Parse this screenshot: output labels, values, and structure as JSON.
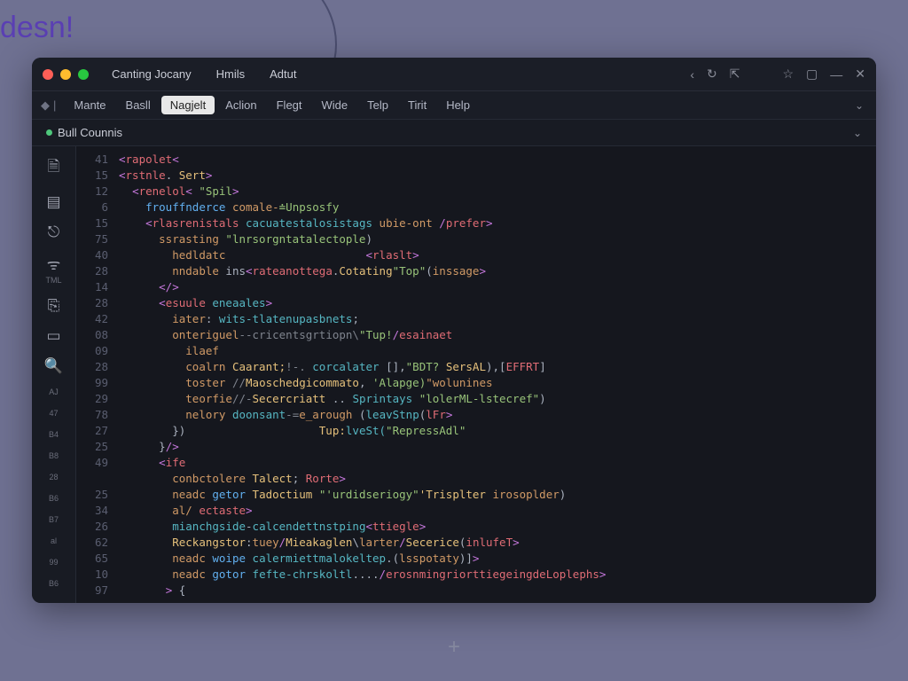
{
  "background": {
    "partial_word": "desn!"
  },
  "titlebar": {
    "tabs": [
      "Canting Jocany",
      "Hmils",
      "Adtut"
    ],
    "nav": {
      "back": "‹",
      "reload": "↻",
      "forward": "⇱",
      "star": "☆",
      "panel": "▢",
      "minimize": "—",
      "close": "✕"
    }
  },
  "menubar": {
    "pre_icon": "◆",
    "pre_sep": "|",
    "items": [
      "Mante",
      "Basll",
      "Nagjelt",
      "Aclion",
      "Flegt",
      "Wide",
      "Telp",
      "Tirit",
      "Help"
    ],
    "active_index": 2,
    "end": "⌄"
  },
  "tabbar": {
    "file_name": "Bull Counnis",
    "end": "⌄"
  },
  "activity": [
    {
      "icon": "🗎",
      "label": ""
    },
    {
      "icon": "▤",
      "label": ""
    },
    {
      "icon": "⎋",
      "label": ""
    },
    {
      "icon": "ᯤ",
      "label": "TML"
    },
    {
      "icon": "⎘",
      "label": ""
    },
    {
      "icon": "▭",
      "label": ""
    },
    {
      "icon": "🔍",
      "label": ""
    },
    {
      "icon": "",
      "label": "AJ"
    },
    {
      "icon": "",
      "label": "47"
    },
    {
      "icon": "",
      "label": "B4"
    },
    {
      "icon": "",
      "label": "B8"
    },
    {
      "icon": "",
      "label": "28"
    },
    {
      "icon": "",
      "label": "B6"
    },
    {
      "icon": "",
      "label": "B7"
    },
    {
      "icon": "",
      "label": "al"
    },
    {
      "icon": "",
      "label": "99"
    },
    {
      "icon": "",
      "label": "B6"
    }
  ],
  "gutter": [
    "41",
    "15",
    "12",
    "6",
    "15",
    "75",
    "40",
    "28",
    "14",
    "28",
    "42",
    "08",
    "09",
    "28",
    "99",
    "29",
    "78",
    "27",
    "25",
    "49",
    "",
    "25",
    "34",
    "26",
    "62",
    "65",
    "10",
    "97"
  ],
  "code_lines": [
    [
      {
        "c": "p",
        "t": "<"
      },
      {
        "c": "t",
        "t": "rapolet"
      },
      {
        "c": "p",
        "t": "<"
      }
    ],
    [
      {
        "c": "p",
        "t": "<"
      },
      {
        "c": "t",
        "t": "rstnle"
      },
      {
        "c": "w",
        "t": ". "
      },
      {
        "c": "y",
        "t": "Sert"
      },
      {
        "c": "p",
        "t": ">"
      }
    ],
    [
      {
        "c": "w",
        "t": "  "
      },
      {
        "c": "p",
        "t": "<"
      },
      {
        "c": "t",
        "t": "renelol"
      },
      {
        "c": "p",
        "t": "< "
      },
      {
        "c": "s",
        "t": "\"Spil"
      },
      {
        "c": "p",
        "t": ">"
      }
    ],
    [
      {
        "c": "w",
        "t": "    "
      },
      {
        "c": "k",
        "t": "frouffnderce"
      },
      {
        "c": "w",
        "t": " "
      },
      {
        "c": "a",
        "t": "comale-"
      },
      {
        "c": "s",
        "t": "≐Unpsosfy"
      }
    ],
    [
      {
        "c": "w",
        "t": "    "
      },
      {
        "c": "p",
        "t": "<"
      },
      {
        "c": "t",
        "t": "rlasrenistals"
      },
      {
        "c": "w",
        "t": " "
      },
      {
        "c": "g",
        "t": "cacuatestalosistags"
      },
      {
        "c": "w",
        "t": " "
      },
      {
        "c": "a",
        "t": "ubie-ont"
      },
      {
        "c": "w",
        "t": " "
      },
      {
        "c": "p",
        "t": "/"
      },
      {
        "c": "t",
        "t": "prefer"
      },
      {
        "c": "p",
        "t": ">"
      }
    ],
    [
      {
        "c": "w",
        "t": "      "
      },
      {
        "c": "a",
        "t": "ssrasting"
      },
      {
        "c": "w",
        "t": " "
      },
      {
        "c": "s",
        "t": "\"lnrsorgntatalectople"
      },
      {
        "c": "w",
        "t": ")"
      }
    ],
    [
      {
        "c": "w",
        "t": "        "
      },
      {
        "c": "a",
        "t": "hedldatc"
      },
      {
        "c": "w",
        "t": "                     "
      },
      {
        "c": "p",
        "t": "<"
      },
      {
        "c": "t",
        "t": "rlaslt"
      },
      {
        "c": "p",
        "t": ">"
      }
    ],
    [
      {
        "c": "w",
        "t": "        "
      },
      {
        "c": "a",
        "t": "nndable"
      },
      {
        "c": "w",
        "t": " ins"
      },
      {
        "c": "p",
        "t": "<"
      },
      {
        "c": "t",
        "t": "rateanottega"
      },
      {
        "c": "w",
        "t": "."
      },
      {
        "c": "y",
        "t": "Cotating"
      },
      {
        "c": "s",
        "t": "\"Top\""
      },
      {
        "c": "w",
        "t": "("
      },
      {
        "c": "a",
        "t": "inssage"
      },
      {
        "c": "p",
        "t": ">"
      }
    ],
    [
      {
        "c": "w",
        "t": "      "
      },
      {
        "c": "p",
        "t": "</"
      },
      {
        "c": "p",
        "t": ">"
      }
    ],
    [
      {
        "c": "w",
        "t": "      "
      },
      {
        "c": "p",
        "t": "<"
      },
      {
        "c": "t",
        "t": "esuule"
      },
      {
        "c": "w",
        "t": " "
      },
      {
        "c": "g",
        "t": "eneaales"
      },
      {
        "c": "p",
        "t": ">"
      }
    ],
    [
      {
        "c": "w",
        "t": "        "
      },
      {
        "c": "a",
        "t": "iater"
      },
      {
        "c": "w",
        "t": ": "
      },
      {
        "c": "g",
        "t": "wits-tlatenupasbnets"
      },
      {
        "c": "w",
        "t": ";"
      }
    ],
    [
      {
        "c": "w",
        "t": "        "
      },
      {
        "c": "a",
        "t": "onteriguel"
      },
      {
        "c": "c",
        "t": "--cricentsgrtiopn\\"
      },
      {
        "c": "s",
        "t": "\"Tup!"
      },
      {
        "c": "p",
        "t": "/"
      },
      {
        "c": "t",
        "t": "esainaet"
      }
    ],
    [
      {
        "c": "w",
        "t": "          "
      },
      {
        "c": "a",
        "t": "ilaef"
      }
    ],
    [
      {
        "c": "w",
        "t": "          "
      },
      {
        "c": "a",
        "t": "coalrn"
      },
      {
        "c": "w",
        "t": " "
      },
      {
        "c": "y",
        "t": "Caarant;"
      },
      {
        "c": "c",
        "t": "!-. "
      },
      {
        "c": "g",
        "t": "corcalater"
      },
      {
        "c": "w",
        "t": " [],"
      },
      {
        "c": "s",
        "t": "\"BDT?"
      },
      {
        "c": "w",
        "t": " "
      },
      {
        "c": "y",
        "t": "SersAL"
      },
      {
        "c": "w",
        "t": "),["
      },
      {
        "c": "t",
        "t": "EFFRT"
      },
      {
        "c": "w",
        "t": "]"
      }
    ],
    [
      {
        "c": "w",
        "t": "          "
      },
      {
        "c": "a",
        "t": "toster"
      },
      {
        "c": "w",
        "t": " "
      },
      {
        "c": "c",
        "t": "//"
      },
      {
        "c": "y",
        "t": "Maoschedgicommato"
      },
      {
        "c": "w",
        "t": ", "
      },
      {
        "c": "s",
        "t": "'Alapge)"
      },
      {
        "c": "a",
        "t": "\"wolunines"
      }
    ],
    [
      {
        "c": "w",
        "t": "          "
      },
      {
        "c": "a",
        "t": "teorfie"
      },
      {
        "c": "c",
        "t": "//-"
      },
      {
        "c": "y",
        "t": "Secercriatt"
      },
      {
        "c": "w",
        "t": " .. "
      },
      {
        "c": "g",
        "t": "Sprintays"
      },
      {
        "c": "w",
        "t": " "
      },
      {
        "c": "s",
        "t": "\"lolerML-lstecref\""
      },
      {
        "c": "w",
        "t": ")"
      }
    ],
    [
      {
        "c": "w",
        "t": "          "
      },
      {
        "c": "a",
        "t": "nelory"
      },
      {
        "c": "w",
        "t": " "
      },
      {
        "c": "g",
        "t": "doonsant"
      },
      {
        "c": "c",
        "t": "-="
      },
      {
        "c": "a",
        "t": "e_arough"
      },
      {
        "c": "w",
        "t": " ("
      },
      {
        "c": "g",
        "t": "leavStnp"
      },
      {
        "c": "w",
        "t": "("
      },
      {
        "c": "t",
        "t": "lFr"
      },
      {
        "c": "p",
        "t": ">"
      }
    ],
    [
      {
        "c": "w",
        "t": "        })                    "
      },
      {
        "c": "y",
        "t": "Tup:"
      },
      {
        "c": "g",
        "t": "lveSt("
      },
      {
        "c": "s",
        "t": "\"RepressAdl\""
      }
    ],
    [
      {
        "c": "w",
        "t": "      }"
      },
      {
        "c": "p",
        "t": "/>"
      }
    ],
    [
      {
        "c": "w",
        "t": "      "
      },
      {
        "c": "p",
        "t": "<"
      },
      {
        "c": "t",
        "t": "ife"
      }
    ],
    [
      {
        "c": "w",
        "t": "        "
      },
      {
        "c": "a",
        "t": "conbctolere"
      },
      {
        "c": "w",
        "t": " "
      },
      {
        "c": "y",
        "t": "Talect"
      },
      {
        "c": "w",
        "t": "; "
      },
      {
        "c": "t",
        "t": "Rorte"
      },
      {
        "c": "p",
        "t": ">"
      }
    ],
    [
      {
        "c": "w",
        "t": "        "
      },
      {
        "c": "a",
        "t": "neadc "
      },
      {
        "c": "k",
        "t": "getor"
      },
      {
        "c": "w",
        "t": " "
      },
      {
        "c": "y",
        "t": "Tadoctium"
      },
      {
        "c": "w",
        "t": " "
      },
      {
        "c": "s",
        "t": "\"'urdidseriogy\""
      },
      {
        "c": "y",
        "t": "'Trisplter"
      },
      {
        "c": "w",
        "t": " "
      },
      {
        "c": "a",
        "t": "irosoplder"
      },
      {
        "c": "w",
        "t": ")"
      }
    ],
    [
      {
        "c": "w",
        "t": "        "
      },
      {
        "c": "a",
        "t": "al/ "
      },
      {
        "c": "t",
        "t": "ectaste"
      },
      {
        "c": "p",
        "t": ">"
      }
    ],
    [
      {
        "c": "w",
        "t": "        "
      },
      {
        "c": "g",
        "t": "mianchgside"
      },
      {
        "c": "w",
        "t": "-"
      },
      {
        "c": "g",
        "t": "calcendettnstping"
      },
      {
        "c": "p",
        "t": "<"
      },
      {
        "c": "t",
        "t": "ttiegle"
      },
      {
        "c": "p",
        "t": ">"
      }
    ],
    [
      {
        "c": "w",
        "t": "        "
      },
      {
        "c": "y",
        "t": "Reckangstor"
      },
      {
        "c": "w",
        "t": ":"
      },
      {
        "c": "a",
        "t": "tuey"
      },
      {
        "c": "p",
        "t": "/"
      },
      {
        "c": "y",
        "t": "Mieakaglen"
      },
      {
        "c": "w",
        "t": "\\"
      },
      {
        "c": "a",
        "t": "larter"
      },
      {
        "c": "p",
        "t": "/"
      },
      {
        "c": "y",
        "t": "Secerice"
      },
      {
        "c": "w",
        "t": "("
      },
      {
        "c": "t",
        "t": "inlufeT"
      },
      {
        "c": "p",
        "t": ">"
      }
    ],
    [
      {
        "c": "w",
        "t": "        "
      },
      {
        "c": "a",
        "t": "neadc "
      },
      {
        "c": "k",
        "t": "woipe"
      },
      {
        "c": "w",
        "t": " "
      },
      {
        "c": "g",
        "t": "calermiettmalokeltep"
      },
      {
        "c": "w",
        "t": ".("
      },
      {
        "c": "a",
        "t": "lsspotaty"
      },
      {
        "c": "w",
        "t": ")]"
      },
      {
        "c": "p",
        "t": ">"
      }
    ],
    [
      {
        "c": "w",
        "t": "        "
      },
      {
        "c": "a",
        "t": "neadc "
      },
      {
        "c": "k",
        "t": "gotor"
      },
      {
        "c": "w",
        "t": " "
      },
      {
        "c": "g",
        "t": "fefte-chrskoltl"
      },
      {
        "c": "w",
        "t": "...."
      },
      {
        "c": "p",
        "t": "/"
      },
      {
        "c": "t",
        "t": "erosnmingriorttiegeingdeLoplephs"
      },
      {
        "c": "p",
        "t": ">"
      }
    ],
    [
      {
        "c": "w",
        "t": "       "
      },
      {
        "c": "p",
        "t": ">"
      },
      {
        "c": "w",
        "t": " {"
      }
    ]
  ],
  "plus": "+"
}
